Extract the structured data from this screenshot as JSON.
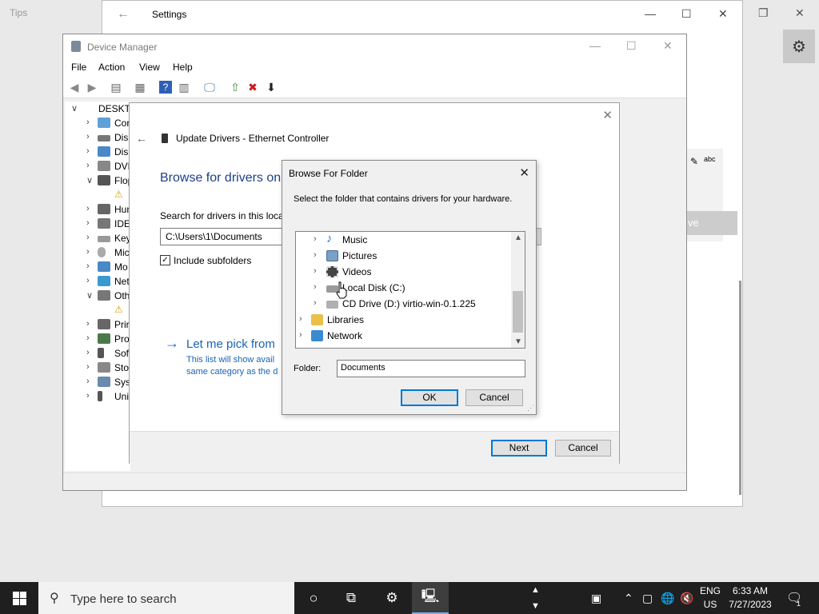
{
  "background_app": {
    "title": "Tips"
  },
  "settings": {
    "title": "Settings",
    "partial_button": "ve"
  },
  "device_manager": {
    "title": "Device Manager",
    "menu": [
      "File",
      "Action",
      "View",
      "Help"
    ],
    "tree": [
      {
        "label": "DESKTOP",
        "expander": "∨"
      },
      {
        "label": "Cor",
        "expander": "›"
      },
      {
        "label": "Disk",
        "expander": "›"
      },
      {
        "label": "Disp",
        "expander": "›"
      },
      {
        "label": "DVD",
        "expander": "›"
      },
      {
        "label": "Flop",
        "expander": "∨"
      },
      {
        "label": "",
        "expander": ""
      },
      {
        "label": "Hun",
        "expander": "›"
      },
      {
        "label": "IDE",
        "expander": "›"
      },
      {
        "label": "Key",
        "expander": "›"
      },
      {
        "label": "Mic",
        "expander": "›"
      },
      {
        "label": "Mo",
        "expander": "›"
      },
      {
        "label": "Net",
        "expander": "›"
      },
      {
        "label": "Oth",
        "expander": "∨"
      },
      {
        "label": "",
        "expander": ""
      },
      {
        "label": "Prir",
        "expander": "›"
      },
      {
        "label": "Pro",
        "expander": "›"
      },
      {
        "label": "Soft",
        "expander": "›"
      },
      {
        "label": "Stor",
        "expander": "›"
      },
      {
        "label": "Syst",
        "expander": "›"
      },
      {
        "label": "Uni",
        "expander": "›"
      }
    ]
  },
  "wizard": {
    "title": "Update Drivers - Ethernet Controller",
    "heading": "Browse for drivers on",
    "search_label": "Search for drivers in this locat",
    "path_value": "C:\\Users\\1\\Documents",
    "include_subfolders": "Include subfolders",
    "pick_link": "Let me pick from",
    "pick_desc_1": "This list will show avail",
    "pick_desc_2": "same category as the d",
    "next": "Next",
    "cancel": "Cancel"
  },
  "browse_dialog": {
    "title": "Browse For Folder",
    "instruction": "Select the folder that contains drivers for your hardware.",
    "items": [
      {
        "label": "Music",
        "icon": "music-icon"
      },
      {
        "label": "Pictures",
        "icon": "pictures-icon"
      },
      {
        "label": "Videos",
        "icon": "videos-icon"
      },
      {
        "label": "Local Disk (C:)",
        "icon": "drive-icon"
      },
      {
        "label": "CD Drive (D:) virtio-win-0.1.225",
        "icon": "cd-drive-icon"
      },
      {
        "label": "Libraries",
        "icon": "libraries-icon"
      },
      {
        "label": "Network",
        "icon": "network-icon"
      }
    ],
    "folder_label": "Folder:",
    "folder_value": "Documents",
    "ok": "OK",
    "cancel": "Cancel"
  },
  "taskbar": {
    "search_placeholder": "Type here to search",
    "lang_1": "ENG",
    "lang_2": "US",
    "time": "6:33 AM",
    "date": "7/27/2023",
    "notification_count": "1"
  }
}
